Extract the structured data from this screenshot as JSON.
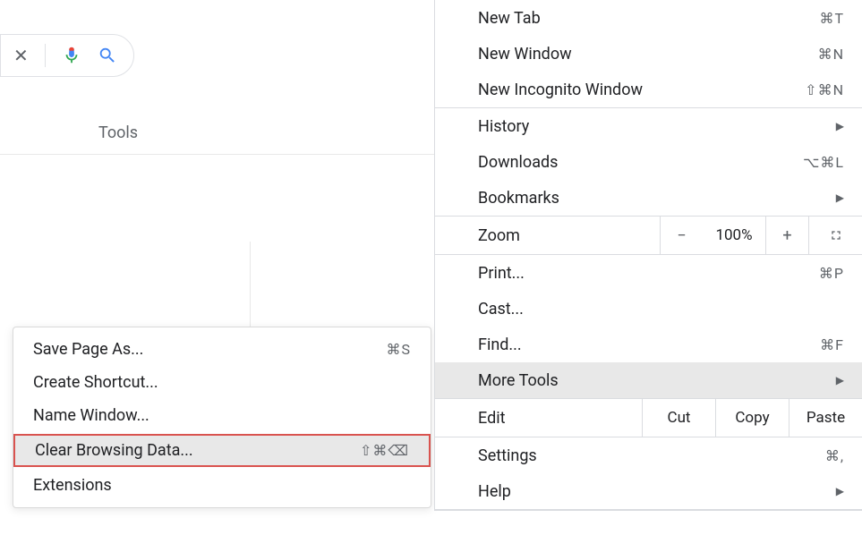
{
  "search_bar": {
    "clear_icon": "✕"
  },
  "tools_label": "Tools",
  "submenu": {
    "items": [
      {
        "label": "Save Page As...",
        "shortcut": "⌘S"
      },
      {
        "label": "Create Shortcut...",
        "shortcut": ""
      },
      {
        "label": "Name Window...",
        "shortcut": ""
      },
      {
        "label": "Clear Browsing Data...",
        "shortcut": "⇧⌘⌫",
        "highlight": true
      },
      {
        "label": "Extensions",
        "shortcut": ""
      }
    ]
  },
  "menu": {
    "new_tab": {
      "label": "New Tab",
      "shortcut": "⌘T"
    },
    "new_window": {
      "label": "New Window",
      "shortcut": "⌘N"
    },
    "new_incognito": {
      "label": "New Incognito Window",
      "shortcut": "⇧⌘N"
    },
    "history": {
      "label": "History"
    },
    "downloads": {
      "label": "Downloads",
      "shortcut": "⌥⌘L"
    },
    "bookmarks": {
      "label": "Bookmarks"
    },
    "zoom": {
      "label": "Zoom",
      "value": "100%",
      "minus": "−",
      "plus": "+"
    },
    "print": {
      "label": "Print...",
      "shortcut": "⌘P"
    },
    "cast": {
      "label": "Cast..."
    },
    "find": {
      "label": "Find...",
      "shortcut": "⌘F"
    },
    "more_tools": {
      "label": "More Tools"
    },
    "edit": {
      "label": "Edit",
      "cut": "Cut",
      "copy": "Copy",
      "paste": "Paste"
    },
    "settings": {
      "label": "Settings",
      "shortcut": "⌘,"
    },
    "help": {
      "label": "Help"
    }
  }
}
